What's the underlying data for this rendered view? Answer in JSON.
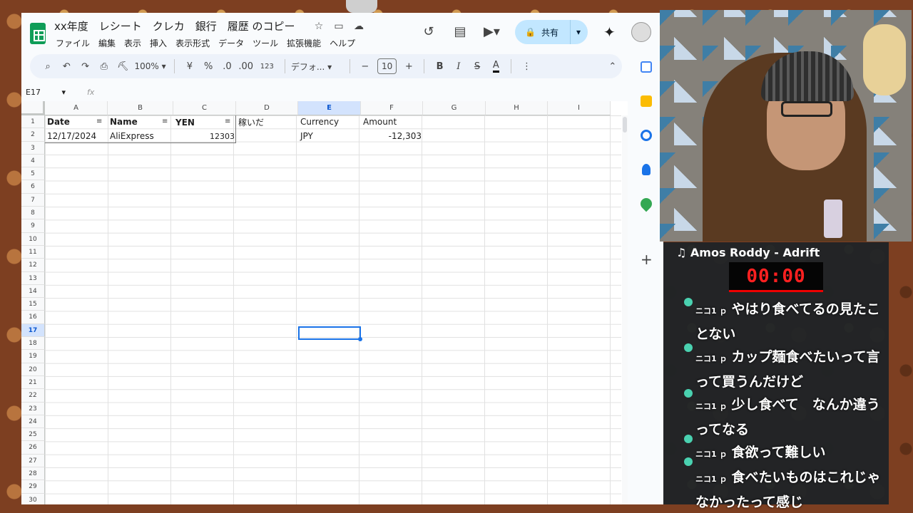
{
  "window": {
    "title": "xx年度　レシート　クレカ　銀行　履歴 のコピー",
    "menus": [
      "ファイル",
      "編集",
      "表示",
      "挿入",
      "表示形式",
      "データ",
      "ツール",
      "拡張機能",
      "ヘルプ"
    ],
    "share_label": "共有"
  },
  "toolbar": {
    "zoom": "100%",
    "currency": "¥",
    "percent": "%",
    "dec_decrease": ".0",
    "dec_increase": ".00",
    "number_format": "123",
    "font": "デフォ...",
    "font_size": "10",
    "bold": "B",
    "italic": "I",
    "strike": "S",
    "text_color": "A"
  },
  "formula_bar": {
    "name_box": "E17",
    "fx": "fx"
  },
  "sheet": {
    "columns": [
      "A",
      "B",
      "C",
      "D",
      "E",
      "F",
      "G",
      "H",
      "I"
    ],
    "selected_column": "E",
    "rows": [
      "1",
      "2",
      "3",
      "4",
      "5",
      "6",
      "7",
      "8",
      "9",
      "10",
      "11",
      "12",
      "13",
      "14",
      "15",
      "16",
      "17",
      "18",
      "19",
      "20",
      "21",
      "22",
      "23",
      "24",
      "25",
      "26",
      "27",
      "28",
      "29",
      "30"
    ],
    "selected_row": "17",
    "headers": {
      "A": "Date",
      "B": "Name",
      "C": "YEN",
      "D": "稼いだ",
      "E": "Currency",
      "F": "Amount"
    },
    "row2": {
      "A": "12/17/2024",
      "B": "AliExpress",
      "C": "12303",
      "E": "JPY",
      "F": "-12,303"
    }
  },
  "stream": {
    "song": "♫ Amos Roddy - Adrift",
    "timer": "00:00",
    "chat": [
      {
        "user": "ニコ1 ｐ",
        "text": "やはり食べてるの見たことない"
      },
      {
        "user": "ニコ1 ｐ",
        "text": "カップ麺食べたいって言って買うんだけど"
      },
      {
        "user": "ニコ1 ｐ",
        "text": "少し食べて　なんか違うってなる"
      },
      {
        "user": "ニコ1 ｐ",
        "text": "食欲って難しい"
      },
      {
        "user": "ニコ1 ｐ",
        "text": "食べたいものはこれじゃなかったって感じ"
      }
    ]
  },
  "colors": {
    "sheets_green": "#0f9d58",
    "share_bg": "#c2e7ff",
    "selection": "#1a73e8",
    "timer_red": "#ff2020"
  }
}
